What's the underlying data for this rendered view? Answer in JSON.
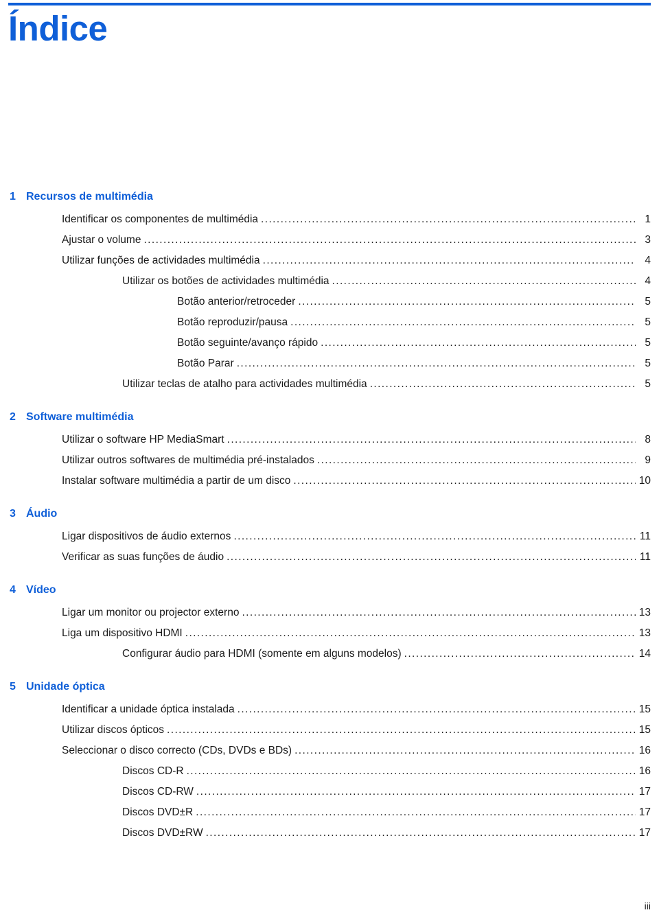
{
  "document": {
    "title": "Índice",
    "folio": "iii",
    "accent_color": "#0f5fd8",
    "text_color": "#1a1a1a"
  },
  "chapters": [
    {
      "number": "1",
      "title": "Recursos de multimédia",
      "entries": [
        {
          "level": 1,
          "label": "Identificar os componentes de multimédia",
          "page": "1"
        },
        {
          "level": 1,
          "label": "Ajustar o volume",
          "page": "3"
        },
        {
          "level": 1,
          "label": "Utilizar funções de actividades multimédia",
          "page": "4"
        },
        {
          "level": 2,
          "label": "Utilizar os botões de actividades multimédia",
          "page": "4"
        },
        {
          "level": 3,
          "label": "Botão anterior/retroceder",
          "page": "5"
        },
        {
          "level": 3,
          "label": "Botão reproduzir/pausa",
          "page": "5"
        },
        {
          "level": 3,
          "label": "Botão seguinte/avanço rápido",
          "page": "5"
        },
        {
          "level": 3,
          "label": "Botão Parar",
          "page": "5"
        },
        {
          "level": 2,
          "label": "Utilizar teclas de atalho para actividades multimédia",
          "page": "5"
        }
      ]
    },
    {
      "number": "2",
      "title": "Software multimédia",
      "entries": [
        {
          "level": 1,
          "label": "Utilizar o software HP MediaSmart",
          "page": "8"
        },
        {
          "level": 1,
          "label": "Utilizar outros softwares de multimédia pré-instalados",
          "page": "9"
        },
        {
          "level": 1,
          "label": "Instalar software multimédia a partir de um disco",
          "page": "10"
        }
      ]
    },
    {
      "number": "3",
      "title": "Áudio",
      "entries": [
        {
          "level": 1,
          "label": "Ligar dispositivos de áudio externos",
          "page": "11"
        },
        {
          "level": 1,
          "label": "Verificar as suas funções de áudio",
          "page": "11"
        }
      ]
    },
    {
      "number": "4",
      "title": "Vídeo",
      "entries": [
        {
          "level": 1,
          "label": "Ligar um monitor ou projector externo",
          "page": "13"
        },
        {
          "level": 1,
          "label": "Liga um dispositivo HDMI",
          "page": "13"
        },
        {
          "level": 2,
          "label": "Configurar áudio para HDMI (somente em alguns modelos)",
          "page": "14"
        }
      ]
    },
    {
      "number": "5",
      "title": "Unidade óptica",
      "entries": [
        {
          "level": 1,
          "label": "Identificar a unidade óptica instalada",
          "page": "15"
        },
        {
          "level": 1,
          "label": "Utilizar discos ópticos",
          "page": "15"
        },
        {
          "level": 1,
          "label": "Seleccionar o disco correcto (CDs, DVDs e BDs)",
          "page": "16"
        },
        {
          "level": 2,
          "label": "Discos CD-R",
          "page": "16"
        },
        {
          "level": 2,
          "label": "Discos CD-RW",
          "page": "17"
        },
        {
          "level": 2,
          "label": "Discos DVD±R",
          "page": "17"
        },
        {
          "level": 2,
          "label": "Discos DVD±RW",
          "page": "17"
        }
      ]
    }
  ]
}
